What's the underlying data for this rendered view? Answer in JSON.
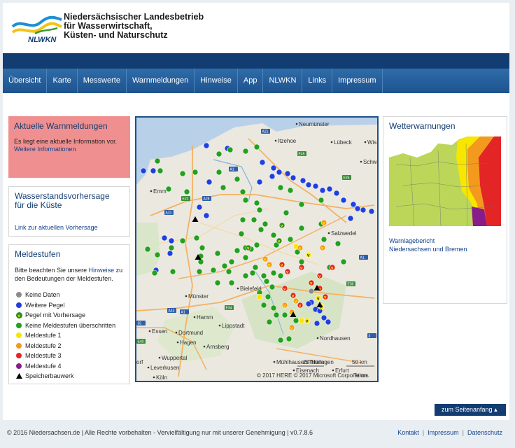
{
  "header": {
    "org_line1": "Niedersächsischer  Landesbetrieb",
    "org_line2": "für Wasserwirtschaft,",
    "org_line3": "Küsten- und Naturschutz",
    "logo_text": "NLWKN"
  },
  "nav": {
    "items": [
      {
        "label": "Übersicht"
      },
      {
        "label": "Karte"
      },
      {
        "label": "Messwerte"
      },
      {
        "label": "Warnmeldungen"
      },
      {
        "label": "Hinweise"
      },
      {
        "label": "App"
      },
      {
        "label": "NLWKN"
      },
      {
        "label": "Links"
      },
      {
        "label": "Impressum"
      }
    ]
  },
  "alert": {
    "title": "Aktuelle Warnmeldungen",
    "text": "Es liegt eine aktuelle Information vor.",
    "link": "Weitere Informationen"
  },
  "forecast": {
    "title_line1": "Wasserstandsvorhersage",
    "title_line2": "für die Küste",
    "link": "Link zur aktuellen Vorhersage"
  },
  "levels": {
    "title": "Meldestufen",
    "intro_pre": "Bitte beachten Sie unsere ",
    "intro_link": "Hinweise",
    "intro_post": " zu den Bedeutungen der Meldestufen.",
    "legend": [
      {
        "label": "Keine Daten",
        "color": "#8c8c8c",
        "kind": "dot"
      },
      {
        "label": "Weitere Pegel",
        "color": "#1f3fe0",
        "kind": "dot"
      },
      {
        "label": "Pegel mit Vorhersage",
        "color": "#2e8b1f",
        "kind": "vdot"
      },
      {
        "label": "Keine Meldestufen überschritten",
        "color": "#22a01e",
        "kind": "dot"
      },
      {
        "label": "Meldestufe 1",
        "color": "#f7e600",
        "kind": "dot"
      },
      {
        "label": "Meldestufe 2",
        "color": "#f39a1e",
        "kind": "dot"
      },
      {
        "label": "Meldestufe 3",
        "color": "#e42525",
        "kind": "dot"
      },
      {
        "label": "Meldestufe 4",
        "color": "#8a1c8a",
        "kind": "dot"
      },
      {
        "label": "Speicherbauwerk",
        "color": "#000000",
        "kind": "triangle"
      }
    ]
  },
  "map": {
    "places": [
      "Neumünster",
      "Itzehoe",
      "Lübeck",
      "Wis",
      "Schw",
      "Salzwedel",
      "Emm",
      "Münster",
      "Bielefeld",
      "Hamm",
      "Lippstadt",
      "Essen",
      "Dortmund",
      "Hagen",
      "Arnsberg",
      "Wuppertal",
      "Leverkusen",
      "Köln",
      "Nordhausen",
      "Mühlhausen/Thüringen",
      "Eisenach",
      "Erfurt",
      "orf"
    ],
    "highways": [
      "A21",
      "E45",
      "A1",
      "E26",
      "E22",
      "A28",
      "A31",
      "A1",
      "E34",
      "A43",
      "A1",
      "E30",
      "35",
      "E40",
      "3"
    ],
    "scale_miles": "25 Meilen",
    "scale_km": "50 km",
    "attribution": "© 2017 HERE © 2017 Microsoft Corporation",
    "terms": "Terms"
  },
  "weather": {
    "title": "Wetterwarnungen",
    "link_line1": "Warnlagebericht",
    "link_line2": "Niedersachsen und Bremen"
  },
  "to_top": "zum Seitenanfang",
  "footer": {
    "copyright": "© 2016 Niedersachsen.de | Alle Rechte vorbehalten - Vervielfältigung nur mit unserer Genehmigung | v0.7.8.6",
    "links": [
      "Kontakt",
      "Impressum",
      "Datenschutz"
    ]
  }
}
